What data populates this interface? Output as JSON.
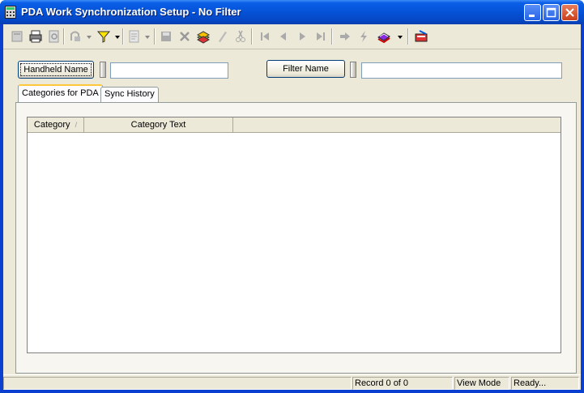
{
  "window": {
    "title": "PDA Work Synchronization Setup - No Filter"
  },
  "toolbar": {
    "buttons": [
      "new-icon",
      "print-icon",
      "preview-icon",
      "query-icon",
      "filter-icon",
      "report-icon",
      "save-icon",
      "delete-icon",
      "copy-records-icon",
      "edit-icon",
      "cut-icon",
      "first-record-icon",
      "previous-record-icon",
      "next-record-icon",
      "last-record-icon",
      "go-icon",
      "lightning-icon",
      "books-icon",
      "exit-icon"
    ]
  },
  "filters": {
    "handheld_button": "Handheld Name",
    "handheld_value": "",
    "filter_button": "Filter Name",
    "filter_value": ""
  },
  "tabs": [
    {
      "label": "Categories for PDA"
    },
    {
      "label": "Sync History"
    }
  ],
  "grid": {
    "columns": [
      "Category",
      "Category Text"
    ],
    "sort_indicator": "/",
    "rows": []
  },
  "status": {
    "record": "Record 0 of 0",
    "mode": "View Mode",
    "state": "Ready..."
  },
  "colors": {
    "titlebar": "#0552d6",
    "face": "#ece9d8"
  }
}
